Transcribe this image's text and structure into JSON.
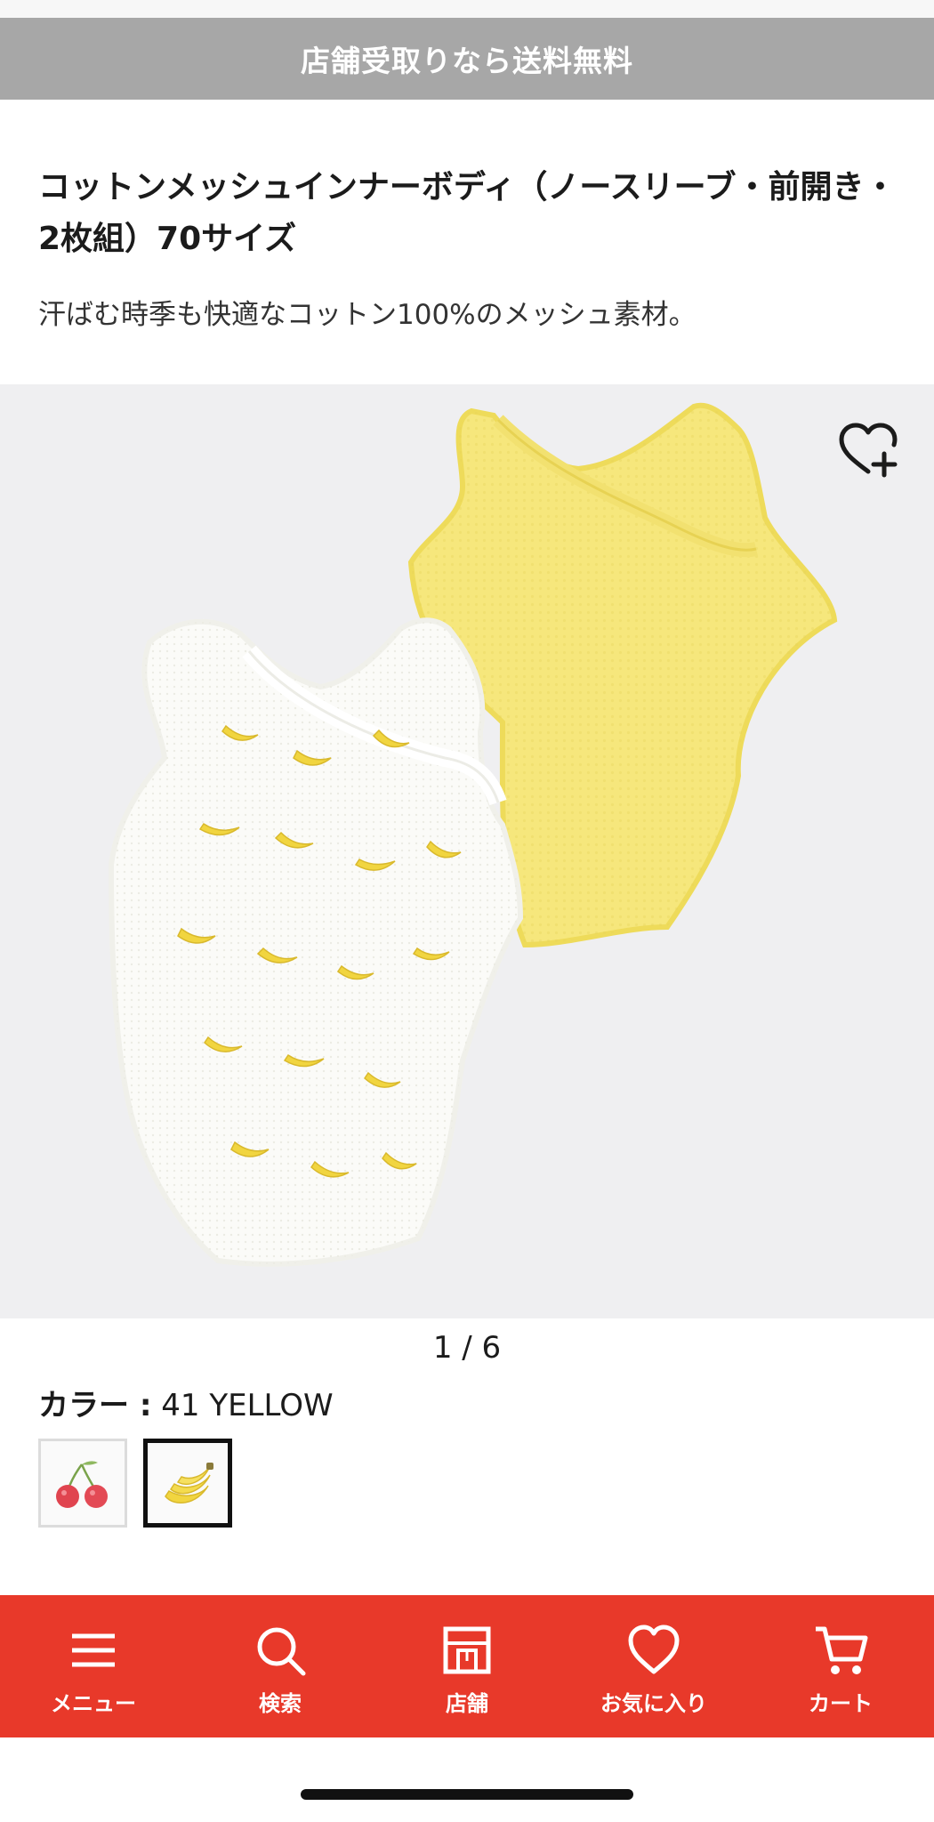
{
  "banner": {
    "text": "店舗受取りなら送料無料"
  },
  "product": {
    "title": "コットンメッシュインナーボディ（ノースリーブ・前開き・2枚組）70サイズ",
    "description": "汗ばむ時季も快適なコットン100%のメッシュ素材。"
  },
  "gallery": {
    "counter": "1 / 6",
    "wishlist_icon": "heart-plus-icon"
  },
  "color": {
    "label": "カラー :",
    "value": "41 YELLOW",
    "swatches": [
      {
        "icon": "cherry-swatch-icon",
        "selected": false
      },
      {
        "icon": "banana-swatch-icon",
        "selected": true
      }
    ]
  },
  "tabbar": {
    "bg_color": "#e8392a",
    "items": [
      {
        "label": "メニュー",
        "icon": "hamburger-icon"
      },
      {
        "label": "検索",
        "icon": "search-icon"
      },
      {
        "label": "店舗",
        "icon": "store-icon"
      },
      {
        "label": "お気に入り",
        "icon": "heart-icon"
      },
      {
        "label": "カート",
        "icon": "cart-icon"
      }
    ]
  }
}
